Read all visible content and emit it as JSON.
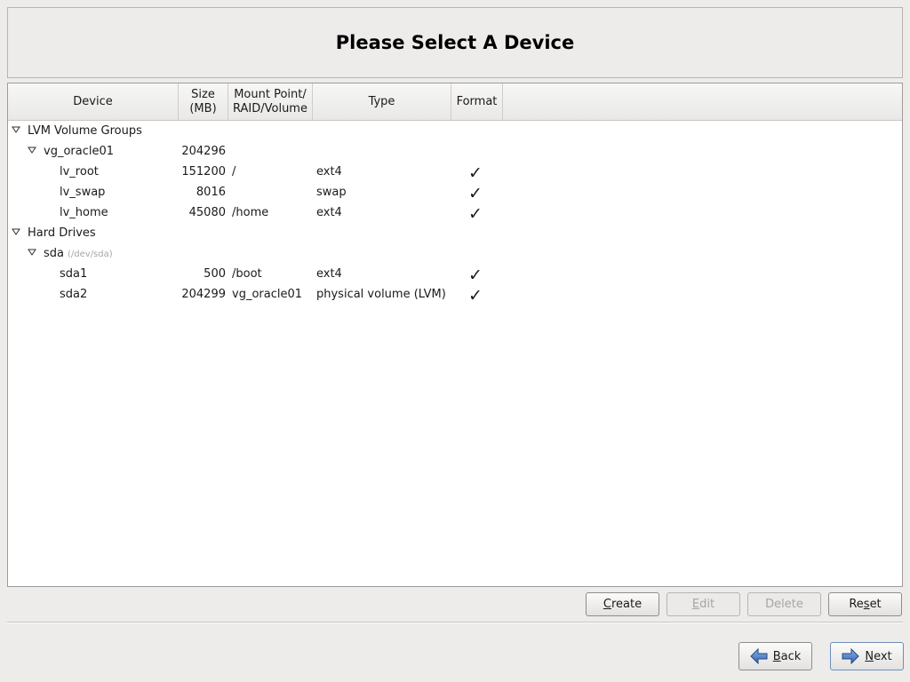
{
  "header": {
    "title": "Please Select A Device"
  },
  "columns": {
    "device": "Device",
    "size": "Size\n(MB)",
    "mount": "Mount Point/\nRAID/Volume",
    "type": "Type",
    "format": "Format"
  },
  "rows": [
    {
      "device": "LVM Volume Groups",
      "size": "",
      "mount": "",
      "type": "",
      "format": "",
      "level": 0,
      "expanded": true
    },
    {
      "device": "vg_oracle01",
      "size": "204296",
      "mount": "",
      "type": "",
      "format": "",
      "level": 1,
      "expanded": true
    },
    {
      "device": "lv_root",
      "size": "151200",
      "mount": "/",
      "type": "ext4",
      "format": "✓",
      "level": 2
    },
    {
      "device": "lv_swap",
      "size": "8016",
      "mount": "",
      "type": "swap",
      "format": "✓",
      "level": 2
    },
    {
      "device": "lv_home",
      "size": "45080",
      "mount": "/home",
      "type": "ext4",
      "format": "✓",
      "level": 2
    },
    {
      "device": "Hard Drives",
      "size": "",
      "mount": "",
      "type": "",
      "format": "",
      "level": 0,
      "expanded": true
    },
    {
      "device": "sda",
      "devpath": "(/dev/sda)",
      "size": "",
      "mount": "",
      "type": "",
      "format": "",
      "level": 1,
      "expanded": true
    },
    {
      "device": "sda1",
      "size": "500",
      "mount": "/boot",
      "type": "ext4",
      "format": "✓",
      "level": 2
    },
    {
      "device": "sda2",
      "size": "204299",
      "mount": "vg_oracle01",
      "type": "physical volume (LVM)",
      "format": "✓",
      "level": 2
    }
  ],
  "actions": {
    "create": "Create",
    "edit": "Edit",
    "delete": "Delete",
    "reset": "Reset"
  },
  "nav": {
    "back": "Back",
    "next": "Next"
  }
}
